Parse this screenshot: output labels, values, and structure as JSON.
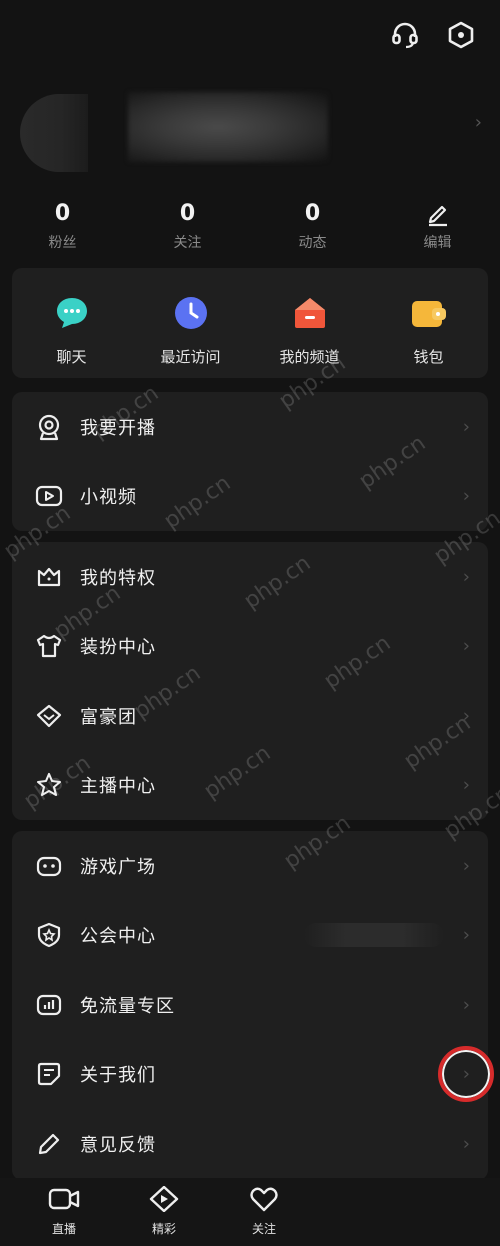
{
  "profile": {
    "chevron": "›"
  },
  "stats": [
    {
      "value": "0",
      "label": "粉丝"
    },
    {
      "value": "0",
      "label": "关注"
    },
    {
      "value": "0",
      "label": "动态"
    }
  ],
  "edit_label": "编辑",
  "quick": [
    {
      "label": "聊天",
      "icon": "chat-icon",
      "color": "#3ad1c6"
    },
    {
      "label": "最近访问",
      "icon": "clock-icon",
      "color": "#5b72f2"
    },
    {
      "label": "我的频道",
      "icon": "home-channel-icon",
      "color": "#f0563a"
    },
    {
      "label": "钱包",
      "icon": "wallet-icon",
      "color": "#f5b73a"
    }
  ],
  "section1": [
    {
      "label": "我要开播",
      "icon": "live-camera-icon"
    },
    {
      "label": "小视频",
      "icon": "video-play-icon"
    }
  ],
  "section2": [
    {
      "label": "我的特权",
      "icon": "crown-icon"
    },
    {
      "label": "装扮中心",
      "icon": "tshirt-icon"
    },
    {
      "label": "富豪团",
      "icon": "diamond-icon"
    },
    {
      "label": "主播中心",
      "icon": "star-icon"
    }
  ],
  "section3": [
    {
      "label": "游戏广场",
      "icon": "gamepad-icon"
    },
    {
      "label": "公会中心",
      "icon": "shield-icon"
    },
    {
      "label": "免流量专区",
      "icon": "bar-chart-icon"
    },
    {
      "label": "关于我们",
      "icon": "note-icon"
    },
    {
      "label": "意见反馈",
      "icon": "pencil-icon"
    }
  ],
  "chevron": "›",
  "bottom_nav": [
    {
      "label": "直播",
      "icon": "video-camera-icon"
    },
    {
      "label": "精彩",
      "icon": "play-diamond-icon"
    },
    {
      "label": "关注",
      "icon": "heart-icon"
    }
  ],
  "watermark": "php.cn"
}
